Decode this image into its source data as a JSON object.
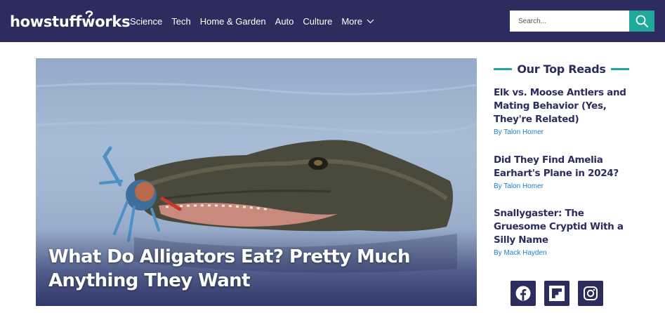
{
  "header": {
    "logo_text": "howstuffworks",
    "nav": [
      {
        "label": "Science"
      },
      {
        "label": "Tech"
      },
      {
        "label": "Home & Garden"
      },
      {
        "label": "Auto"
      },
      {
        "label": "Culture"
      },
      {
        "label": "More"
      }
    ],
    "search": {
      "placeholder": "Search...",
      "icon": "search-icon"
    },
    "colors": {
      "bar": "#2c2c5e",
      "accent": "#1fa99c"
    }
  },
  "hero": {
    "title": "What Do Alligators Eat? Pretty Much Anything They Want",
    "image": "alligator-eating-crab"
  },
  "sidebar": {
    "heading": "Our Top Reads",
    "reads": [
      {
        "title": "Elk vs. Moose Antlers and Mating Behavior (Yes, They're Related)",
        "byline": "By Talon Homer"
      },
      {
        "title": "Did They Find Amelia Earhart's Plane in 2024?",
        "byline": "By Talon Homer"
      },
      {
        "title": "Snallygaster: The Gruesome Cryptid With a Silly Name",
        "byline": "By Mack Hayden"
      }
    ],
    "social": [
      {
        "icon": "facebook-icon"
      },
      {
        "icon": "flipboard-icon"
      },
      {
        "icon": "instagram-icon"
      }
    ]
  }
}
